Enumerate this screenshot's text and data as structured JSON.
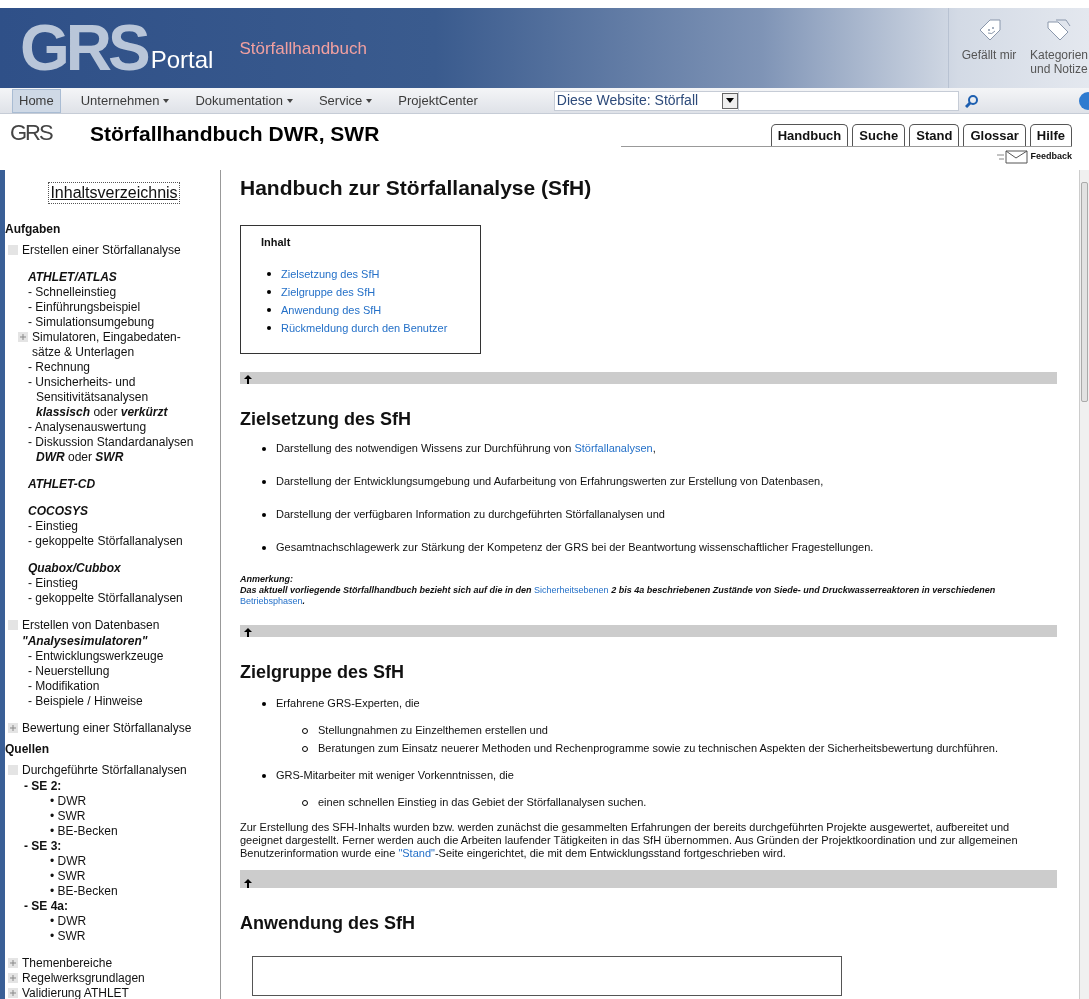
{
  "header": {
    "logo": "GRS",
    "portal": "Portal",
    "site_title": "Störfallhandbuch",
    "actions": [
      {
        "kind": "like",
        "lines": [
          "Gefällt mir"
        ]
      },
      {
        "kind": "tags",
        "lines": [
          "Kategorien",
          "und Notize"
        ]
      }
    ]
  },
  "nav": {
    "items": [
      {
        "label": "Home",
        "dropdown": false,
        "selected": true
      },
      {
        "label": "Unternehmen",
        "dropdown": true,
        "selected": false
      },
      {
        "label": "Dokumentation",
        "dropdown": true,
        "selected": false
      },
      {
        "label": "Service",
        "dropdown": true,
        "selected": false
      },
      {
        "label": "ProjektCenter",
        "dropdown": false,
        "selected": false
      }
    ],
    "search_scope": "Diese Website: Störfall"
  },
  "page_header": {
    "logo": "GRS",
    "title": "Störfallhandbuch DWR, SWR",
    "tabs": [
      "Handbuch",
      "Suche",
      "Stand",
      "Glossar",
      "Hilfe"
    ],
    "feedback": "Feedback"
  },
  "sidebar": {
    "title": "Inhaltsverzeichnis",
    "sections": [
      {
        "heading": "Aufgaben",
        "nodes": [
          {
            "label": "Erstellen einer Störfallanalyse",
            "expanded": true,
            "children": [
              {
                "kind": "group",
                "text": "ATHLET/ATLAS"
              },
              {
                "kind": "item",
                "lines": [
                  "- Schnelleinstieg"
                ]
              },
              {
                "kind": "item",
                "lines": [
                  "- Einführungsbeispiel"
                ]
              },
              {
                "kind": "item",
                "lines": [
                  "- Simulationsumgebung"
                ]
              },
              {
                "kind": "expandable",
                "expanded": false,
                "lines": [
                  "Simulatoren, Eingabedaten-",
                  "sätze & Unterlagen"
                ]
              },
              {
                "kind": "item",
                "lines": [
                  "- Rechnung"
                ]
              },
              {
                "kind": "item",
                "lines": [
                  "- Unsicherheits- und",
                  "Sensitivitätsanalysen"
                ],
                "note": "**klassisch** oder **verkürzt**"
              },
              {
                "kind": "item",
                "lines": [
                  "- Analysenauswertung"
                ]
              },
              {
                "kind": "item",
                "lines": [
                  "- Diskussion Standardanalysen"
                ],
                "note": "**DWR** oder **SWR**"
              },
              {
                "kind": "group",
                "text": "ATHLET-CD"
              },
              {
                "kind": "group",
                "text": "COCOSYS"
              },
              {
                "kind": "item",
                "lines": [
                  "- Einstieg"
                ]
              },
              {
                "kind": "item",
                "lines": [
                  "- gekoppelte Störfallanalysen"
                ]
              },
              {
                "kind": "group",
                "text": "Quabox/Cubbox"
              },
              {
                "kind": "item",
                "lines": [
                  "- Einstieg"
                ]
              },
              {
                "kind": "item",
                "lines": [
                  "- gekoppelte Störfallanalysen"
                ]
              }
            ]
          },
          {
            "label": "Erstellen von Datenbasen",
            "expanded": true,
            "children": [
              {
                "kind": "subtitle",
                "text": "\"Analysesimulatoren\""
              },
              {
                "kind": "item",
                "lines": [
                  "- Entwicklungswerkzeuge"
                ]
              },
              {
                "kind": "item",
                "lines": [
                  "- Neuerstellung"
                ]
              },
              {
                "kind": "item",
                "lines": [
                  "- Modifikation"
                ]
              },
              {
                "kind": "item",
                "lines": [
                  "- Beispiele / Hinweise"
                ]
              }
            ]
          },
          {
            "label": "Bewertung einer Störfallanalyse",
            "expanded": false
          }
        ]
      },
      {
        "heading": "Quellen",
        "nodes": [
          {
            "label": "Durchgeführte Störfallanalysen",
            "expanded": true,
            "children": [
              {
                "kind": "label",
                "text": "- SE 2:",
                "children": [
                  {
                    "kind": "bullet",
                    "text": "• DWR"
                  },
                  {
                    "kind": "bullet",
                    "text": "• SWR"
                  },
                  {
                    "kind": "bullet",
                    "text": "• BE-Becken"
                  }
                ]
              },
              {
                "kind": "label",
                "text": "- SE 3:",
                "children": [
                  {
                    "kind": "bullet",
                    "text": "• DWR"
                  },
                  {
                    "kind": "bullet",
                    "text": "• SWR"
                  },
                  {
                    "kind": "bullet",
                    "text": "• BE-Becken"
                  }
                ]
              },
              {
                "kind": "label",
                "text": "- SE 4a:",
                "children": [
                  {
                    "kind": "bullet",
                    "text": "• DWR"
                  },
                  {
                    "kind": "bullet",
                    "text": "• SWR"
                  }
                ]
              }
            ]
          },
          {
            "label": "Themenbereiche",
            "expanded": false
          },
          {
            "label": "Regelwerksgrundlagen",
            "expanded": false
          },
          {
            "label": "Validierung ATHLET",
            "expanded": false
          }
        ]
      }
    ]
  },
  "content": {
    "title": "Handbuch zur Störfallanalyse (SfH)",
    "toc": {
      "title": "Inhalt",
      "links": [
        "Zielsetzung des SfH",
        "Zielgruppe des SfH",
        "Anwendung des SfH",
        "Rückmeldung durch den Benutzer"
      ]
    },
    "blocks": [
      {
        "kind": "backtop"
      },
      {
        "kind": "h2",
        "text": "Zielsetzung des SfH"
      },
      {
        "kind": "bullets",
        "items": [
          {
            "parts": [
              {
                "text": "Darstellung des notwendigen Wissens zur Durchführung von ",
                "link": false
              },
              {
                "text": "Störfallanalysen",
                "link": true
              },
              {
                "text": ",",
                "link": false
              }
            ]
          },
          {
            "parts": [
              {
                "text": "Darstellung der Entwicklungsumgebung und Aufarbeitung von Erfahrungswerten zur Erstellung von Datenbasen,",
                "link": false
              }
            ]
          },
          {
            "parts": [
              {
                "text": "Darstellung der verfügbaren Information zu durchgeführten Störfallanalysen und",
                "link": false
              }
            ]
          },
          {
            "parts": [
              {
                "text": "Gesamtnachschlagewerk zur Stärkung der Kompetenz der GRS bei der Beantwortung wissenschaftlicher Fragestellungen.",
                "link": false
              }
            ]
          }
        ]
      },
      {
        "kind": "note",
        "label": "Anmerkung:",
        "parts": [
          {
            "text": "Das aktuell vorliegende Störfallhandbuch bezieht sich auf die in den ",
            "link": false
          },
          {
            "text": "Sicherheitsebenen",
            "link": true
          },
          {
            "text": " 2 bis 4a beschriebenen Zustände von Siede- und Druckwasserreaktoren in verschiedenen ",
            "link": false
          },
          {
            "text": "Betriebsphasen",
            "link": true
          },
          {
            "text": ".",
            "link": false
          }
        ]
      },
      {
        "kind": "backtop"
      },
      {
        "kind": "h2",
        "text": "Zielgruppe des SfH"
      },
      {
        "kind": "groups",
        "items": [
          {
            "text": "Erfahrene GRS-Experten, die",
            "subs": [
              "Stellungnahmen zu Einzelthemen erstellen und",
              "Beratungen zum Einsatz neuerer Methoden und Rechenprogramme sowie zu technischen Aspekten der Sicherheitsbewertung durchführen."
            ]
          },
          {
            "text": "GRS-Mitarbeiter mit weniger Vorkenntnissen, die",
            "subs": [
              "einen schnellen Einstieg in das Gebiet der Störfallanalysen suchen."
            ]
          }
        ]
      },
      {
        "kind": "para",
        "parts": [
          {
            "text": "Zur Erstellung des SFH-Inhalts wurden bzw. werden zunächst die gesammelten Erfahrungen der bereits durchgeführten Projekte ausgewertet, aufbereitet und geeignet dargestellt. Ferner werden auch die Arbeiten laufender Tätigkeiten in das SfH übernommen. Aus Gründen der Projektkoordination und zur allgemeinen Benutzerinformation wurde eine ",
            "link": false
          },
          {
            "text": "\"Stand\"",
            "link": true
          },
          {
            "text": "-Seite eingerichtet, die mit dem Entwicklungsstand fortgeschrieben wird.",
            "link": false
          }
        ]
      },
      {
        "kind": "backtop",
        "tall": true
      },
      {
        "kind": "h2",
        "text": "Anwendung des SfH"
      },
      {
        "kind": "frame"
      }
    ]
  }
}
